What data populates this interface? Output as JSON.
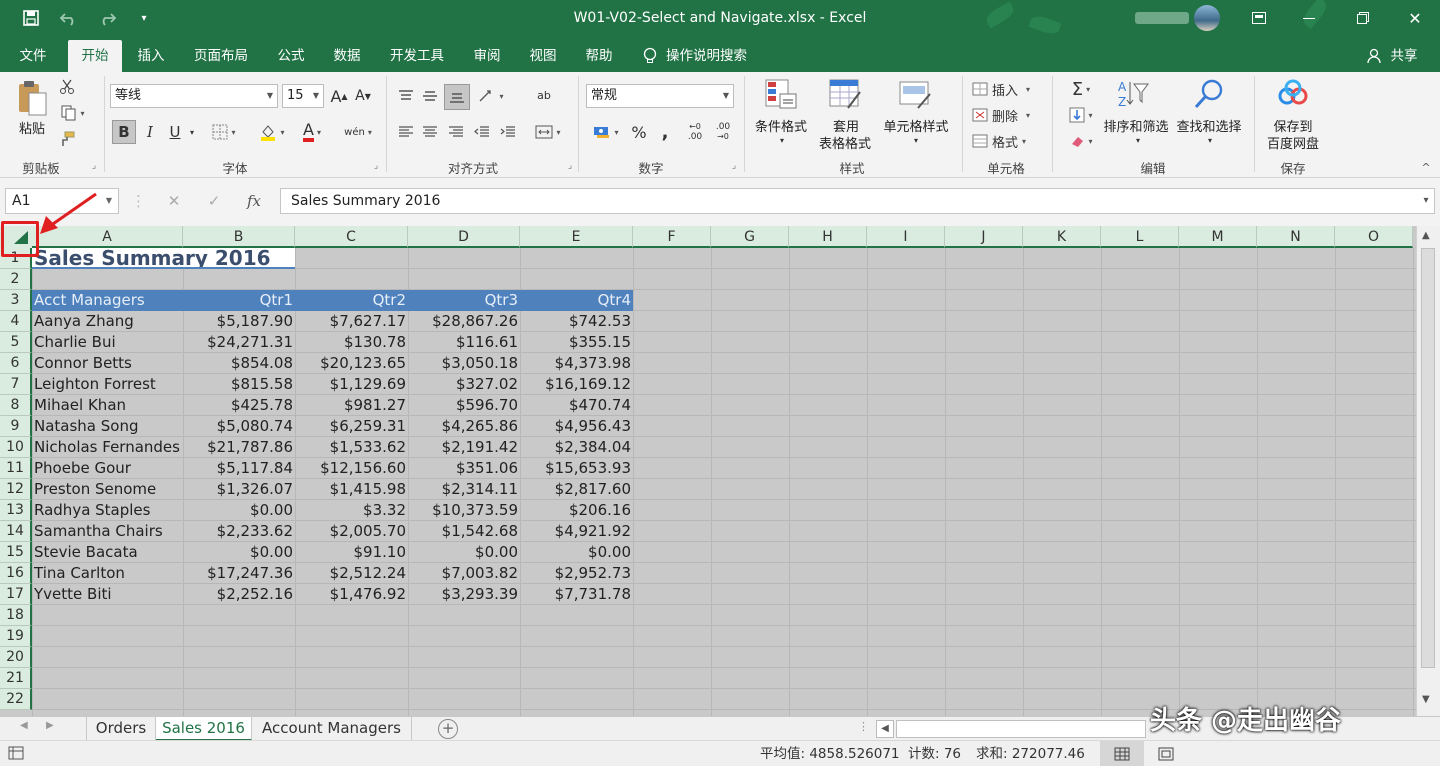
{
  "titlebar": {
    "title": "W01-V02-Select and Navigate.xlsx  -  Excel"
  },
  "tabs": [
    "文件",
    "开始",
    "插入",
    "页面布局",
    "公式",
    "数据",
    "开发工具",
    "审阅",
    "视图",
    "帮助"
  ],
  "tell_me": "操作说明搜索",
  "share": "共享",
  "ribbon": {
    "clipboard": {
      "paste": "粘贴",
      "group": "剪贴板"
    },
    "font": {
      "name": "等线",
      "size": "15",
      "group": "字体",
      "grow": "A",
      "shrink": "A",
      "bold": "B",
      "italic": "I",
      "underline": "U",
      "font_color_glyph": "A",
      "phonetic": "wén"
    },
    "alignment": {
      "group": "对齐方式",
      "wrap_glyph": "ab"
    },
    "number": {
      "format": "常规",
      "group": "数字",
      "percent": "%",
      "comma": ",",
      "inc_dec": ".00",
      "dec_dec": ".00"
    },
    "styles": {
      "conditional": "条件格式",
      "table_line1": "套用",
      "table_line2": "表格格式",
      "cell_styles": "单元格样式",
      "group": "样式"
    },
    "cells": {
      "insert": "插入",
      "delete": "删除",
      "format": "格式",
      "group": "单元格"
    },
    "editing": {
      "sort": "排序和筛选",
      "find": "查找和选择",
      "group": "编辑",
      "sum_glyph": "Σ"
    },
    "save": {
      "line1": "保存到",
      "line2": "百度网盘",
      "group": "保存"
    }
  },
  "formula_bar": {
    "namebox": "A1",
    "cancel": "✕",
    "confirm": "✓",
    "fx": "fx",
    "content": "Sales Summary 2016"
  },
  "columns": [
    "A",
    "B",
    "C",
    "D",
    "E",
    "F",
    "G",
    "H",
    "I",
    "J",
    "K",
    "L",
    "M",
    "N",
    "O"
  ],
  "rows": [
    "1",
    "2",
    "3",
    "4",
    "5",
    "6",
    "7",
    "8",
    "9",
    "10",
    "11",
    "12",
    "13",
    "14",
    "15",
    "16",
    "17",
    "18",
    "19",
    "20",
    "21",
    "22"
  ],
  "sheet": {
    "title": "Sales Summary 2016",
    "headers": [
      "Acct Managers",
      "Qtr1",
      "Qtr2",
      "Qtr3",
      "Qtr4"
    ],
    "data": [
      [
        "Aanya Zhang",
        "$5,187.90",
        "$7,627.17",
        "$28,867.26",
        "$742.53"
      ],
      [
        "Charlie Bui",
        "$24,271.31",
        "$130.78",
        "$116.61",
        "$355.15"
      ],
      [
        "Connor Betts",
        "$854.08",
        "$20,123.65",
        "$3,050.18",
        "$4,373.98"
      ],
      [
        "Leighton Forrest",
        "$815.58",
        "$1,129.69",
        "$327.02",
        "$16,169.12"
      ],
      [
        "Mihael Khan",
        "$425.78",
        "$981.27",
        "$596.70",
        "$470.74"
      ],
      [
        "Natasha Song",
        "$5,080.74",
        "$6,259.31",
        "$4,265.86",
        "$4,956.43"
      ],
      [
        "Nicholas Fernandes",
        "$21,787.86",
        "$1,533.62",
        "$2,191.42",
        "$2,384.04"
      ],
      [
        "Phoebe Gour",
        "$5,117.84",
        "$12,156.60",
        "$351.06",
        "$15,653.93"
      ],
      [
        "Preston Senome",
        "$1,326.07",
        "$1,415.98",
        "$2,314.11",
        "$2,817.60"
      ],
      [
        "Radhya Staples",
        "$0.00",
        "$3.32",
        "$10,373.59",
        "$206.16"
      ],
      [
        "Samantha Chairs",
        "$2,233.62",
        "$2,005.70",
        "$1,542.68",
        "$4,921.92"
      ],
      [
        "Stevie Bacata",
        "$0.00",
        "$91.10",
        "$0.00",
        "$0.00"
      ],
      [
        "Tina Carlton",
        "$17,247.36",
        "$2,512.24",
        "$7,003.82",
        "$2,952.73"
      ],
      [
        "Yvette Biti",
        "$2,252.16",
        "$1,476.92",
        "$3,293.39",
        "$7,731.78"
      ]
    ]
  },
  "sheet_tabs": [
    "Orders",
    "Sales 2016",
    "Account Managers"
  ],
  "active_sheet": "Sales 2016",
  "status": {
    "average": "平均值: 4858.526071",
    "count": "计数: 76",
    "sum": "求和: 272077.46"
  },
  "watermark": "头条 @走出幽谷",
  "colors": {
    "excel_green": "#217346",
    "header_fill": "#4f81bd",
    "selection_gray": "#c9c9c9",
    "annotation_red": "#e02020"
  },
  "icons": [
    "save-icon",
    "undo-icon",
    "redo-icon",
    "customize-icon",
    "ribbon-display-icon",
    "minimize-icon",
    "restore-icon",
    "close-icon",
    "lightbulb-icon",
    "user-icon",
    "paste-icon",
    "cut-icon",
    "copy-icon",
    "format-painter-icon",
    "select-all-triangle-icon",
    "annotation-arrow-icon",
    "add-sheet-icon"
  ]
}
